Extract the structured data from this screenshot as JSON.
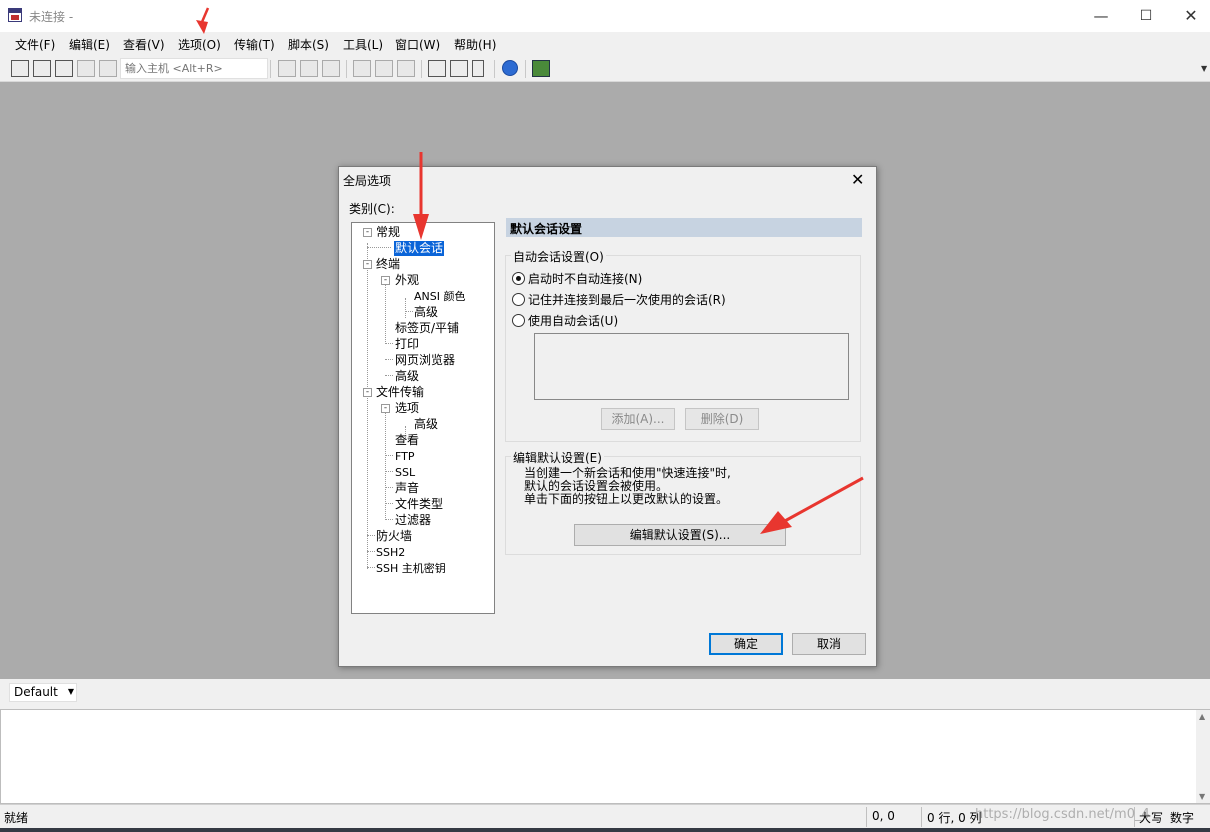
{
  "window": {
    "title": "未连接 -",
    "min_glyph": "—",
    "max_glyph": "☐",
    "close_glyph": "✕"
  },
  "menu": [
    "文件(F)",
    "编辑(E)",
    "查看(V)",
    "选项(O)",
    "传输(T)",
    "脚本(S)",
    "工具(L)",
    "窗口(W)",
    "帮助(H)"
  ],
  "toolbar": {
    "host_placeholder": "输入主机 <Alt+R>"
  },
  "dialog": {
    "title": "全局选项",
    "close_glyph": "✕",
    "category_label": "类别(C):",
    "tree": [
      {
        "label": "常规",
        "exp": "-"
      },
      {
        "label": "默认会话",
        "selected": true
      },
      {
        "label": "终端",
        "exp": "-"
      },
      {
        "label": "外观",
        "exp": "-"
      },
      {
        "label": "ANSI 颜色"
      },
      {
        "label": "高级"
      },
      {
        "label": "标签页/平铺"
      },
      {
        "label": "打印"
      },
      {
        "label": "网页浏览器"
      },
      {
        "label": "高级"
      },
      {
        "label": "文件传输",
        "exp": "-"
      },
      {
        "label": "选项",
        "exp": "-"
      },
      {
        "label": "高级"
      },
      {
        "label": "查看"
      },
      {
        "label": "FTP"
      },
      {
        "label": "SSL"
      },
      {
        "label": "声音"
      },
      {
        "label": "文件类型"
      },
      {
        "label": "过滤器"
      },
      {
        "label": "防火墙"
      },
      {
        "label": "SSH2"
      },
      {
        "label": "SSH 主机密钥"
      }
    ],
    "section_title": "默认会话设置",
    "auto_group": {
      "title": "自动会话设置(O)",
      "options": [
        {
          "label": "启动时不自动连接(N)",
          "checked": true
        },
        {
          "label": "记住并连接到最后一次使用的会话(R)",
          "checked": false
        },
        {
          "label": "使用自动会话(U)",
          "checked": false
        }
      ],
      "add_label": "添加(A)...",
      "delete_label": "删除(D)"
    },
    "edit_group": {
      "title": "编辑默认设置(E)",
      "description": "当创建一个新会话和使用\"快速连接\"时,\n默认的会话设置会被使用。\n单击下面的按钮上以更改默认的设置。",
      "button_label": "编辑默认设置(S)..."
    },
    "ok_label": "确定",
    "cancel_label": "取消"
  },
  "session": {
    "selected": "Default",
    "dropdown_glyph": "▼"
  },
  "status": {
    "ready": "就绪",
    "cursor_pos": "0, 0",
    "row_col": "0 行, 0 列",
    "caps": "大写",
    "num": "数字"
  },
  "watermark": "https://blog.csdn.net/m0_4",
  "colors": {
    "annotation_arrow": "#e8362f",
    "selection": "#0a64d8",
    "section_header": "#c7d3e1",
    "workspace": "#ababab"
  }
}
